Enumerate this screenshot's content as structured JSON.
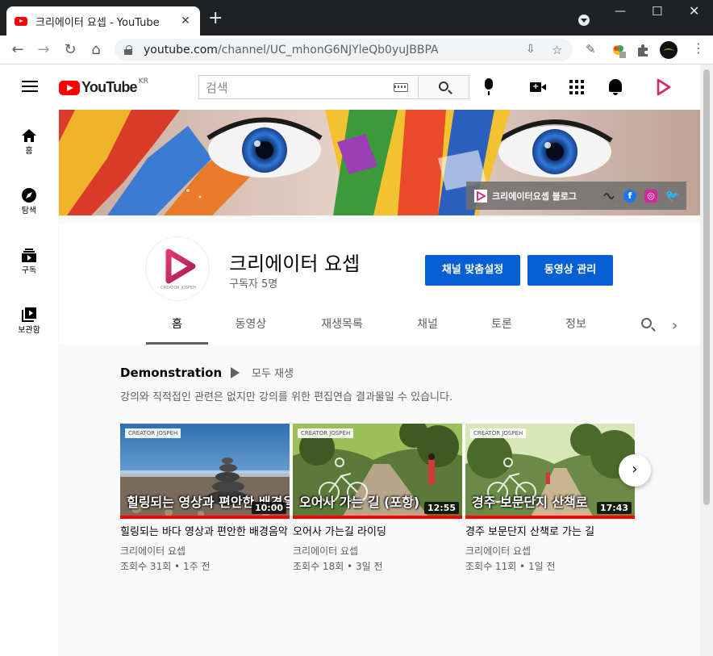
{
  "browser": {
    "tab_title": "크리에이터 요셉 - YouTube",
    "url_host": "youtube.com",
    "url_path": "/channel/UC_mhonG6NJYleQb0yuJBBPA"
  },
  "masthead": {
    "logo_text": "YouTube",
    "logo_region": "KR",
    "search_placeholder": "검색"
  },
  "sidebar": {
    "items": [
      {
        "label": "홈",
        "icon": "home-icon"
      },
      {
        "label": "탐색",
        "icon": "compass-icon"
      },
      {
        "label": "구독",
        "icon": "subscriptions-icon"
      },
      {
        "label": "보관함",
        "icon": "library-icon"
      }
    ]
  },
  "banner": {
    "blog_label": "크리에이터요셉 블로그"
  },
  "channel": {
    "name": "크리에이터 요셉",
    "subscribers": "구독자 5명",
    "avatar_caption": "CREATOR JOSPEH",
    "customize_button": "채널 맞춤설정",
    "manage_button": "동영상 관리",
    "tabs": [
      "홈",
      "동영상",
      "재생목록",
      "채널",
      "토론",
      "정보"
    ],
    "active_tab": 0
  },
  "shelf": {
    "title": "Demonstration",
    "play_all": "모두 재생",
    "description": "강의와 직적접인 관련은 없지만 강의를 위한 편집연습 결과물일 수 있습니다.",
    "videos": [
      {
        "title": "힐링되는 바다 영상과 편안한 배경음악",
        "channel": "크리에이터 요셉",
        "meta": "조회수 31회 • 1주 전",
        "duration": "10:00",
        "overlay": "힐링되는 영상과 편안한 배경음악",
        "brand": "CREATOR JOSPEH",
        "progress": 1.0
      },
      {
        "title": "오어사 가는길 라이딩",
        "channel": "크리에이터 요셉",
        "meta": "조회수 18회 • 3일 전",
        "duration": "12:55",
        "overlay": "오어사 가는 길 (포항)",
        "brand": "CREATOR JOSPEH",
        "progress": 1.0
      },
      {
        "title": "경주 보문단지 산책로 가는 길",
        "channel": "크리에이터 요셉",
        "meta": "조회수 11회 • 1일 전",
        "duration": "17:43",
        "overlay": "경주 보문단지 산책로",
        "brand": "CREATOR JOSPEH",
        "progress": 1.0
      }
    ]
  },
  "colors": {
    "brand_red": "#ff0000",
    "accent_blue": "#065fd4",
    "channel_magenta": "#d6246e"
  }
}
